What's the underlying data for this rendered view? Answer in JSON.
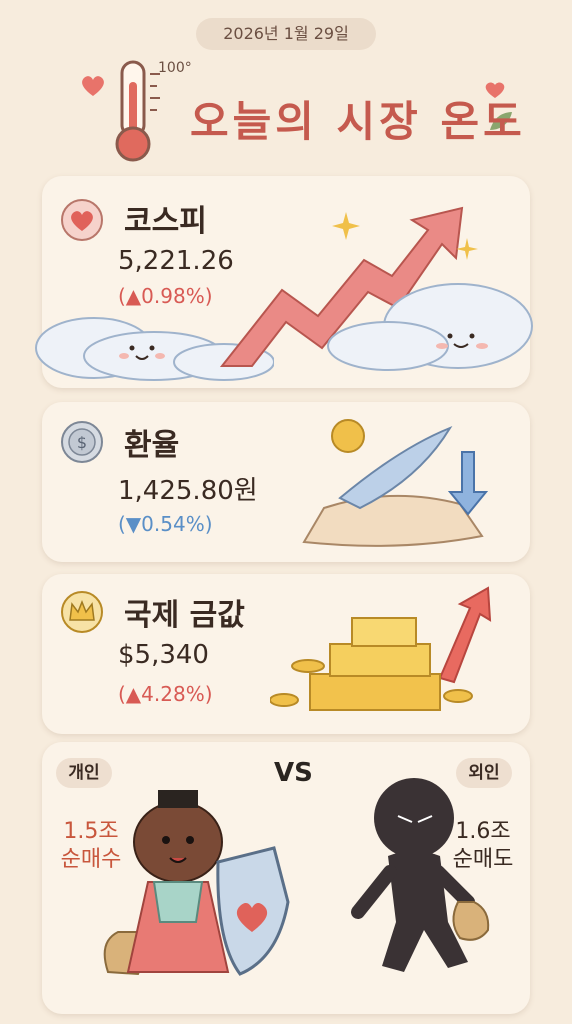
{
  "date": "2026년 1월 29일",
  "title": "오늘의 시장 온도",
  "thermometer": {
    "label": "100°"
  },
  "cards": {
    "kospi": {
      "label": "코스피",
      "value": "5,221.26",
      "change": "(▲0.98%)",
      "icon": "heart-icon"
    },
    "fx": {
      "label": "환율",
      "value": "1,425.80원",
      "change": "(▼0.54%)",
      "icon": "coin-icon"
    },
    "gold": {
      "label": "국제 금값",
      "value": "$5,340",
      "change": "(▲4.28%)",
      "icon": "crown-icon"
    }
  },
  "investors": {
    "individual": {
      "tag": "개인",
      "amount_line1": "1.5조",
      "amount_line2": "순매수"
    },
    "vs": "VS",
    "foreign": {
      "tag": "외인",
      "amount_line1": "1.6조",
      "amount_line2": "순매도"
    }
  },
  "colors": {
    "background": "#f7ecdd",
    "card": "#fbf3e8",
    "up": "#d85a54",
    "down": "#5a8fc7",
    "title": "#c55a4e",
    "gold": "#e8b535"
  }
}
